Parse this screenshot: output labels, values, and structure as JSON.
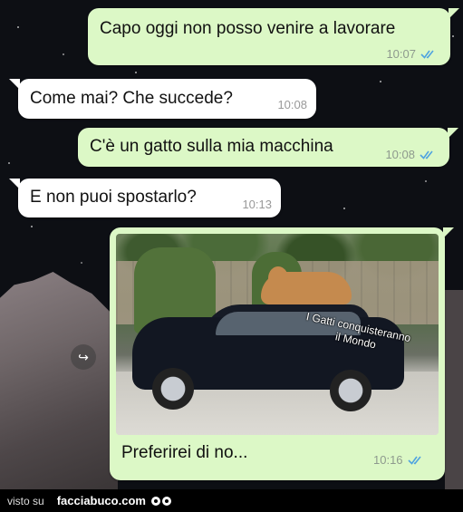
{
  "messages": [
    {
      "text": "Capo oggi non posso venire a lavorare",
      "time": "10:07",
      "direction": "out",
      "read": true
    },
    {
      "text": "Come mai? Che succede?",
      "time": "10:08",
      "direction": "in"
    },
    {
      "text": "C'è un gatto sulla mia macchina",
      "time": "10:08",
      "direction": "out",
      "read": true
    },
    {
      "text": "E non puoi spostarlo?",
      "time": "10:13",
      "direction": "in"
    },
    {
      "text": "Preferirei di no...",
      "time": "10:16",
      "direction": "out",
      "read": true
    }
  ],
  "photo": {
    "overlay_text": "I Gatti conquisteranno il Mondo"
  },
  "forward_icon": "forward-icon",
  "footer": {
    "visto_su": "visto su",
    "site": "facciabuco.com"
  },
  "colors": {
    "outgoing_bubble": "#dcf8c6",
    "incoming_bubble": "#ffffff",
    "read_check": "#4fc3f7"
  }
}
